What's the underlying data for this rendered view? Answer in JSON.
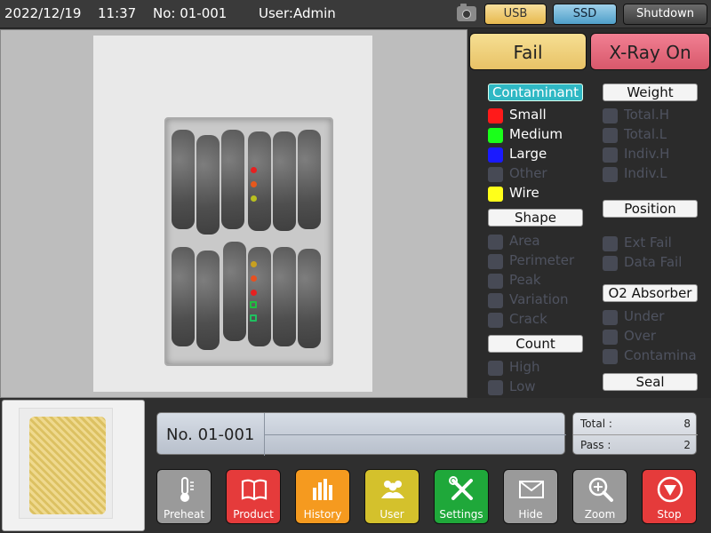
{
  "topbar": {
    "date": "2022/12/19",
    "time": "11:37",
    "no_label": "No: 01-001",
    "user_label": "User:Admin",
    "usb": "USB",
    "ssd": "SSD",
    "shutdown": "Shutdown"
  },
  "status": {
    "result": "Fail",
    "xray": "X-Ray On"
  },
  "contaminant": {
    "header": "Contaminant",
    "items": [
      {
        "label": "Small",
        "color": "#ff1a1a",
        "active": true
      },
      {
        "label": "Medium",
        "color": "#1aff1a",
        "active": true
      },
      {
        "label": "Large",
        "color": "#1a1aff",
        "active": true
      },
      {
        "label": "Other",
        "color": "#474a55",
        "active": false
      },
      {
        "label": "Wire",
        "color": "#ffff1a",
        "active": true
      }
    ]
  },
  "weight": {
    "header": "Weight",
    "items": [
      "Total.H",
      "Total.L",
      "Indiv.H",
      "Indiv.L"
    ]
  },
  "shape": {
    "header": "Shape",
    "items": [
      "Area",
      "Perimeter",
      "Peak",
      "Variation",
      "Crack"
    ]
  },
  "position": {
    "header": "Position",
    "items": [
      "Ext Fail",
      "Data Fail"
    ]
  },
  "o2": {
    "header": "O2 Absorber",
    "items": [
      "Under",
      "Over",
      "Contamina"
    ]
  },
  "count_group": {
    "header": "Count",
    "items": [
      "High",
      "Low"
    ]
  },
  "seal": {
    "header": "Seal"
  },
  "lot": {
    "number": "No. 01-001"
  },
  "counts": {
    "total_label": "Total :",
    "total_value": "8",
    "pass_label": "Pass :",
    "pass_value": "2"
  },
  "buttons": [
    {
      "label": "Preheat",
      "icon": "thermometer-icon",
      "bg": "#9a9a9a"
    },
    {
      "label": "Product",
      "icon": "book-icon",
      "bg": "#e53b3b"
    },
    {
      "label": "History",
      "icon": "bar-chart-icon",
      "bg": "#f59a1f"
    },
    {
      "label": "User",
      "icon": "users-icon",
      "bg": "#d4c12c"
    },
    {
      "label": "Settings",
      "icon": "tools-icon",
      "bg": "#1fa83a"
    },
    {
      "label": "Hide",
      "icon": "hide-icon",
      "bg": "#9a9a9a"
    },
    {
      "label": "Zoom",
      "icon": "zoom-icon",
      "bg": "#9a9a9a"
    },
    {
      "label": "Stop",
      "icon": "stop-icon",
      "bg": "#e53b3b"
    }
  ]
}
